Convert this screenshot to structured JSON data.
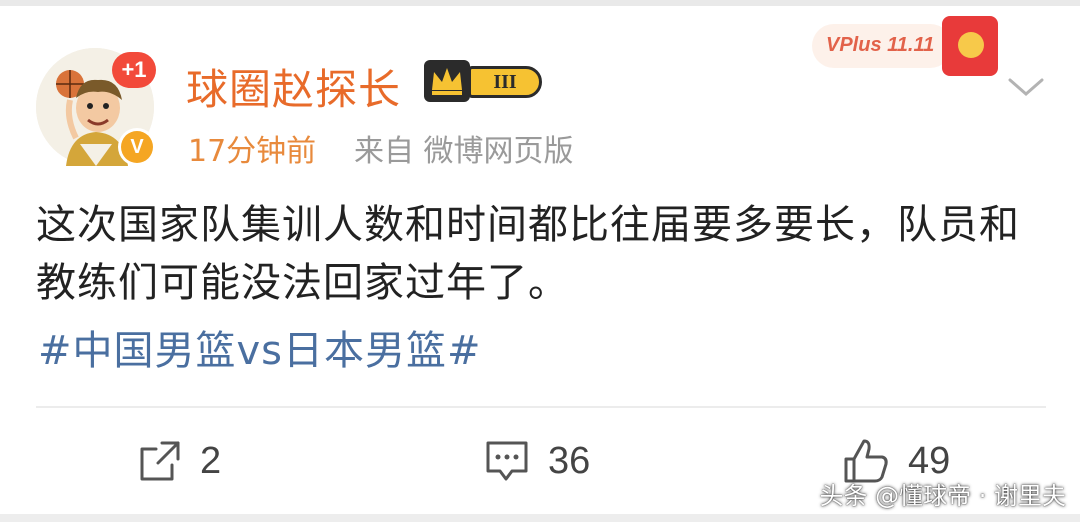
{
  "post": {
    "author": "球圈赵探长",
    "avatar_badge": "+1",
    "verified_mark": "V",
    "rank_badge": "III",
    "time": "17分钟前",
    "source": "来自 微博网页版",
    "text": "这次国家队集训人数和时间都比往届要多要长，队员和教练们可能没法回家过年了。",
    "hashtag": "#中国男篮vs日本男篮#",
    "promo_label": "VPlus 11.11"
  },
  "actions": {
    "share_count": "2",
    "comment_count": "36",
    "like_count": "49"
  },
  "watermark": "头条 @懂球帝 · 谢里夫",
  "colors": {
    "username": "#e86b2a",
    "time": "#e88a3c",
    "hashtag": "#4a6fa0",
    "badge_red": "#f24a3a",
    "verified_gold": "#f5a623"
  },
  "icons": [
    "share-icon",
    "comment-icon",
    "like-icon",
    "chevron-down-icon",
    "crown-icon"
  ]
}
